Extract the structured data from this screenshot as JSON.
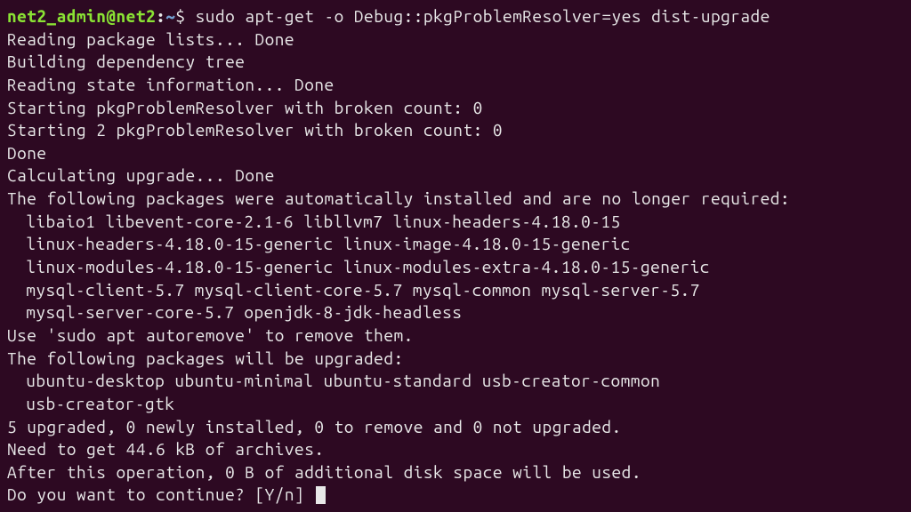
{
  "prompt": {
    "user_host": "net2_admin@net2",
    "colon": ":",
    "path": "~",
    "dollar": "$ "
  },
  "command": "sudo apt-get -o Debug::pkgProblemResolver=yes  dist-upgrade",
  "lines": {
    "l1": "Reading package lists... Done",
    "l2": "Building dependency tree",
    "l3": "Reading state information... Done",
    "l4": "Starting pkgProblemResolver with broken count: 0",
    "l5": "Starting 2 pkgProblemResolver with broken count: 0",
    "l6": "Done",
    "l7": "Calculating upgrade... Done",
    "l8": "The following packages were automatically installed and are no longer required:",
    "l9": "libaio1 libevent-core-2.1-6 libllvm7 linux-headers-4.18.0-15",
    "l10": "linux-headers-4.18.0-15-generic linux-image-4.18.0-15-generic",
    "l11": "linux-modules-4.18.0-15-generic linux-modules-extra-4.18.0-15-generic",
    "l12": "mysql-client-5.7 mysql-client-core-5.7 mysql-common mysql-server-5.7",
    "l13": "mysql-server-core-5.7 openjdk-8-jdk-headless",
    "l14": "Use 'sudo apt autoremove' to remove them.",
    "l15": "The following packages will be upgraded:",
    "l16": "ubuntu-desktop ubuntu-minimal ubuntu-standard usb-creator-common",
    "l17": "usb-creator-gtk",
    "l18": "5 upgraded, 0 newly installed, 0 to remove and 0 not upgraded.",
    "l19": "Need to get 44.6 kB of archives.",
    "l20": "After this operation, 0 B of additional disk space will be used.",
    "l21": "Do you want to continue? [Y/n] "
  }
}
